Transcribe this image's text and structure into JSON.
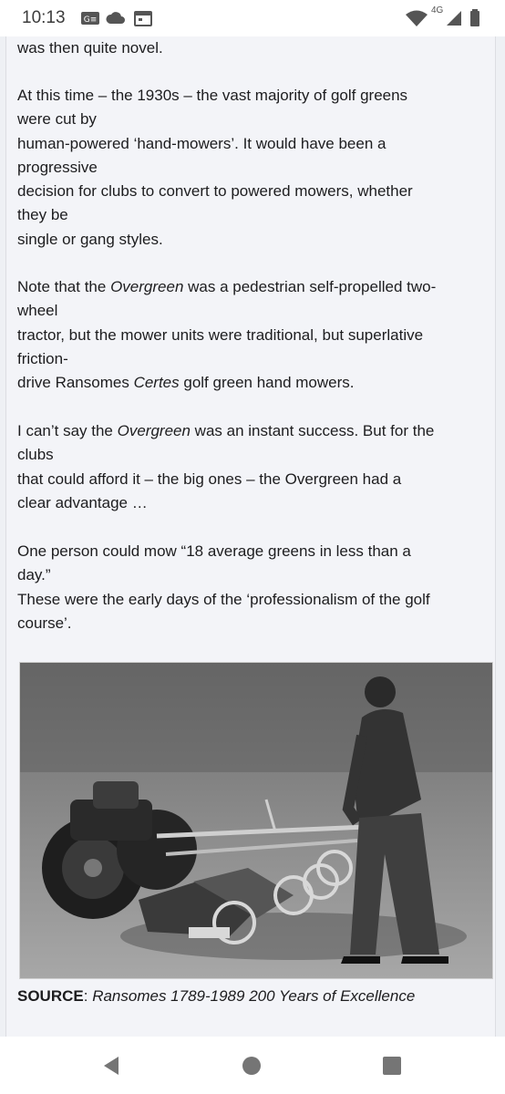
{
  "status_bar": {
    "time": "10:13",
    "network": "4G",
    "left_icons": [
      "news-icon",
      "cloud-icon",
      "calendar-icon"
    ],
    "right_icons": [
      "wifi-icon",
      "signal-icon",
      "battery-icon"
    ]
  },
  "article": {
    "p0": "was then quite novel.",
    "p1_a": "At this time – the 1930s – the vast majority of golf greens\nwere cut by\nhuman-powered ‘hand-mowers’. It would have been a\nprogressive\ndecision for clubs to convert to powered mowers, whether\nthey be\nsingle or gang styles.",
    "p2_a": "Note that the ",
    "p2_em1": "Overgreen",
    "p2_b": " was a pedestrian self-propelled two-\nwheel\ntractor, but the mower units were traditional, but superlative\nfriction-\ndrive Ransomes ",
    "p2_em2": "Certes",
    "p2_c": " golf green hand mowers.",
    "p3_a": "I can’t say the ",
    "p3_em": "Overgreen",
    "p3_b": " was an instant success. But for the\nclubs\nthat could afford it – the big ones – the Overgreen had a\nclear advantage …",
    "p4": "One person could mow “18 average greens in less than a\nday.”\nThese were the early days of the ‘professionalism of the golf\ncourse’.",
    "caption_label": "SOURCE",
    "caption_sep": ": ",
    "caption_text": "Ransomes 1789-1989 200 Years of Excellence"
  },
  "nav": {
    "icons": [
      "back-icon",
      "home-icon",
      "recents-icon"
    ]
  }
}
